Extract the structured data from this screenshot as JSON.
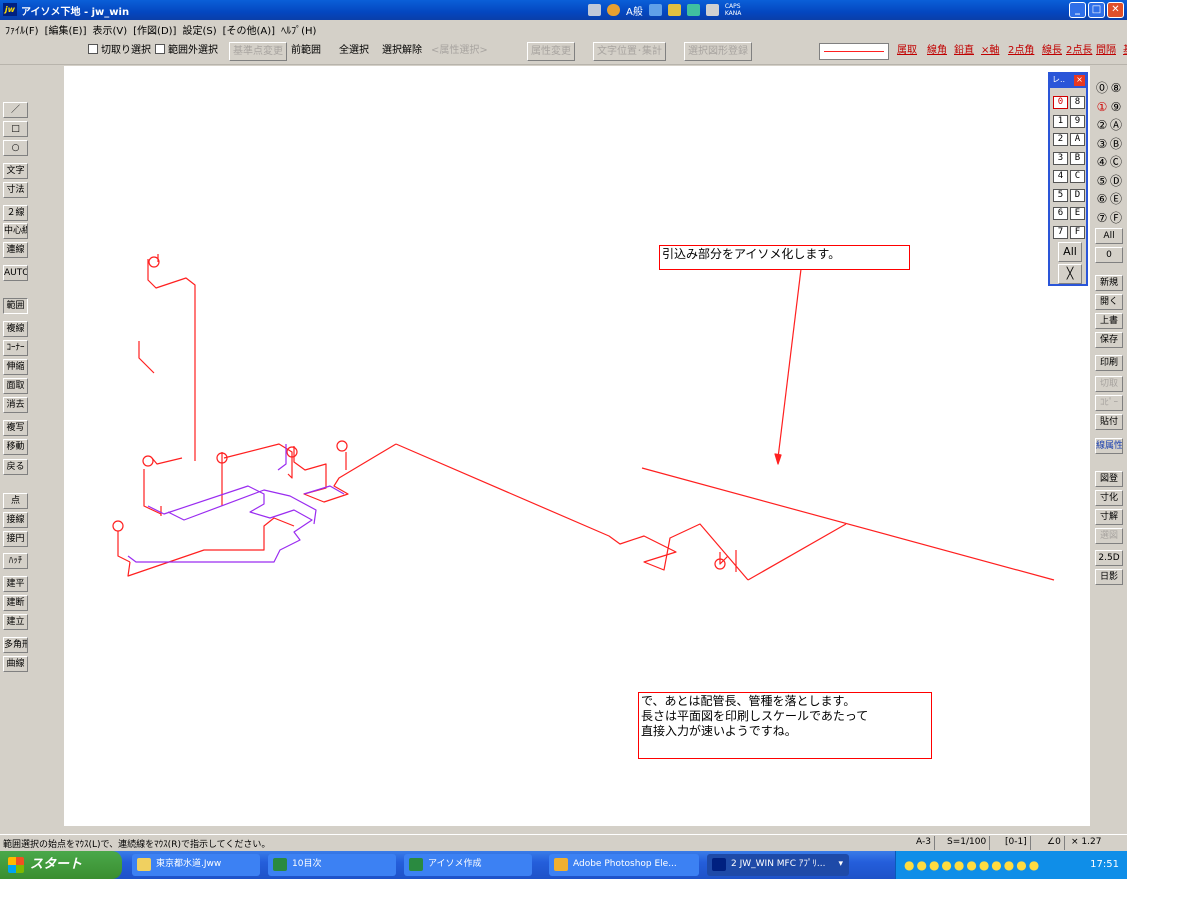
{
  "window": {
    "title": "アイソメ下地 - jw_win",
    "app_icon": "jw",
    "ime": {
      "mode": "A般",
      "caps": "CAPS",
      "kana": "KANA"
    },
    "controls": {
      "minimize": "_",
      "maximize": "□",
      "close": "✕"
    }
  },
  "menu": [
    "ﾌｧｲﾙ(F)",
    "[編集(E)]",
    "表示(V)",
    "[作図(D)]",
    "設定(S)",
    "[その他(A)]",
    "ﾍﾙﾌﾟ(H)"
  ],
  "toolbar": {
    "cut_select": "切取り選択",
    "range_out_select": "範囲外選択",
    "base_point_change": "基準点変更",
    "prev_range": "前範囲",
    "select_all": "全選択",
    "deselect": "選択解除",
    "attr_select": "<属性選択>",
    "attr_change": "属性変更",
    "text_pos_sum": "文字位置･集計",
    "register_shape": "選択図形登録",
    "attr_pick": "属取",
    "line_angle": "線角",
    "plumb": "鉛直",
    "x_axis": "×軸",
    "two_point_angle": "2点角",
    "line_length": "線長",
    "two_point_length": "2点長",
    "interval": "間隔",
    "basic": "基設"
  },
  "left_tools": [
    "／",
    "□",
    "○",
    "文字",
    "寸法",
    "２線",
    "中心線",
    "連線",
    "AUTO",
    "範囲",
    "複線",
    "ｺｰﾅｰ",
    "伸縮",
    "面取",
    "消去",
    "複写",
    "移動",
    "戻る",
    "点",
    "接線",
    "接円",
    "ﾊｯﾁ",
    "建平",
    "建断",
    "建立",
    "多角形",
    "曲線"
  ],
  "layer_panel": {
    "title": "レ..",
    "close": "×",
    "layers_left": [
      "0",
      "1",
      "2",
      "3",
      "4",
      "5",
      "6",
      "7"
    ],
    "layers_right": [
      "8",
      "9",
      "A",
      "B",
      "C",
      "D",
      "E",
      "F"
    ],
    "selected": "0",
    "all": "All",
    "cross": "╳"
  },
  "right_tools": {
    "groups_left": [
      "⓪",
      "①",
      "②",
      "③",
      "④",
      "⑤",
      "⑥",
      "⑦"
    ],
    "groups_right": [
      "⑧",
      "⑨",
      "Ⓐ",
      "Ⓑ",
      "Ⓒ",
      "Ⓓ",
      "Ⓔ",
      "Ⓕ"
    ],
    "all": "All",
    "zero": "0",
    "buttons": [
      "新規",
      "開く",
      "上書",
      "保存",
      "印刷",
      "切取",
      "ｺﾋﾟｰ",
      "貼付",
      "線属性",
      "図登",
      "寸化",
      "寸解",
      "選図",
      "2.5D",
      "日影"
    ]
  },
  "annotations": {
    "note1": "引込み部分をアイソメ化します。",
    "note2": "で、あとは配管長、管種を落とします。\n長さは平面図を印刷しスケールであたって\n直接入力が速いようですね。"
  },
  "status": {
    "message": "範囲選択の始点をﾏｳｽ(L)で、連続線をﾏｳｽ(R)で指示してください。",
    "paper": "A-3",
    "scale": "S=1/100",
    "layer": "[0-1]",
    "angle": "∠0",
    "zoom": "× 1.27"
  },
  "taskbar": {
    "start": "スタート",
    "tasks": [
      "東京都水道.Jww",
      "10目次",
      "アイソメ作成",
      "Adobe Photoshop Ele...",
      "2 JW_WIN MFC ｱﾌﾟﾘ..."
    ],
    "clock": "17:51"
  },
  "colors": {
    "pipe_red": "#ff2020",
    "pipe_purple": "#9a2cf0",
    "titlebar": "#0a5fd8",
    "layer_border": "#2a55d8"
  }
}
